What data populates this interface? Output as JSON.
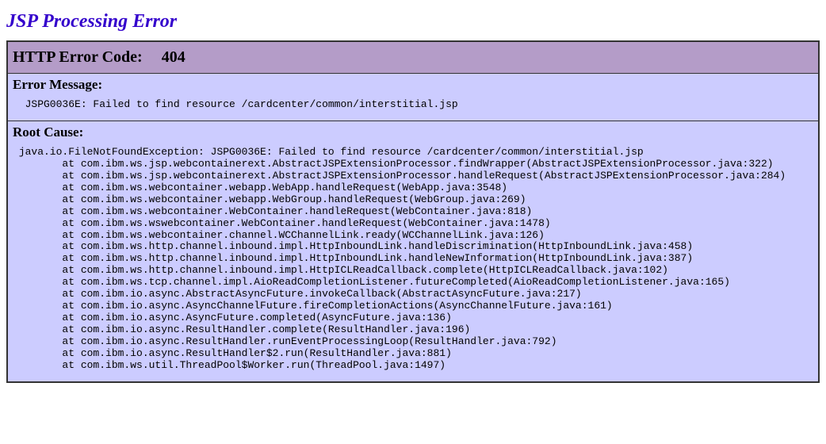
{
  "page_title": "JSP Processing Error",
  "http_error": {
    "label": "HTTP Error Code:",
    "code": "404"
  },
  "error_message": {
    "heading": "Error Message:",
    "text": "JSPG0036E: Failed to find resource /cardcenter/common/interstitial.jsp"
  },
  "root_cause": {
    "heading": "Root Cause:",
    "exception": "java.io.FileNotFoundException: JSPG0036E: Failed to find resource /cardcenter/common/interstitial.jsp",
    "stack": [
      "at com.ibm.ws.jsp.webcontainerext.AbstractJSPExtensionProcessor.findWrapper(AbstractJSPExtensionProcessor.java:322)",
      "at com.ibm.ws.jsp.webcontainerext.AbstractJSPExtensionProcessor.handleRequest(AbstractJSPExtensionProcessor.java:284)",
      "at com.ibm.ws.webcontainer.webapp.WebApp.handleRequest(WebApp.java:3548)",
      "at com.ibm.ws.webcontainer.webapp.WebGroup.handleRequest(WebGroup.java:269)",
      "at com.ibm.ws.webcontainer.WebContainer.handleRequest(WebContainer.java:818)",
      "at com.ibm.ws.wswebcontainer.WebContainer.handleRequest(WebContainer.java:1478)",
      "at com.ibm.ws.webcontainer.channel.WCChannelLink.ready(WCChannelLink.java:126)",
      "at com.ibm.ws.http.channel.inbound.impl.HttpInboundLink.handleDiscrimination(HttpInboundLink.java:458)",
      "at com.ibm.ws.http.channel.inbound.impl.HttpInboundLink.handleNewInformation(HttpInboundLink.java:387)",
      "at com.ibm.ws.http.channel.inbound.impl.HttpICLReadCallback.complete(HttpICLReadCallback.java:102)",
      "at com.ibm.ws.tcp.channel.impl.AioReadCompletionListener.futureCompleted(AioReadCompletionListener.java:165)",
      "at com.ibm.io.async.AbstractAsyncFuture.invokeCallback(AbstractAsyncFuture.java:217)",
      "at com.ibm.io.async.AsyncChannelFuture.fireCompletionActions(AsyncChannelFuture.java:161)",
      "at com.ibm.io.async.AsyncFuture.completed(AsyncFuture.java:136)",
      "at com.ibm.io.async.ResultHandler.complete(ResultHandler.java:196)",
      "at com.ibm.io.async.ResultHandler.runEventProcessingLoop(ResultHandler.java:792)",
      "at com.ibm.io.async.ResultHandler$2.run(ResultHandler.java:881)",
      "at com.ibm.ws.util.ThreadPool$Worker.run(ThreadPool.java:1497)"
    ]
  }
}
